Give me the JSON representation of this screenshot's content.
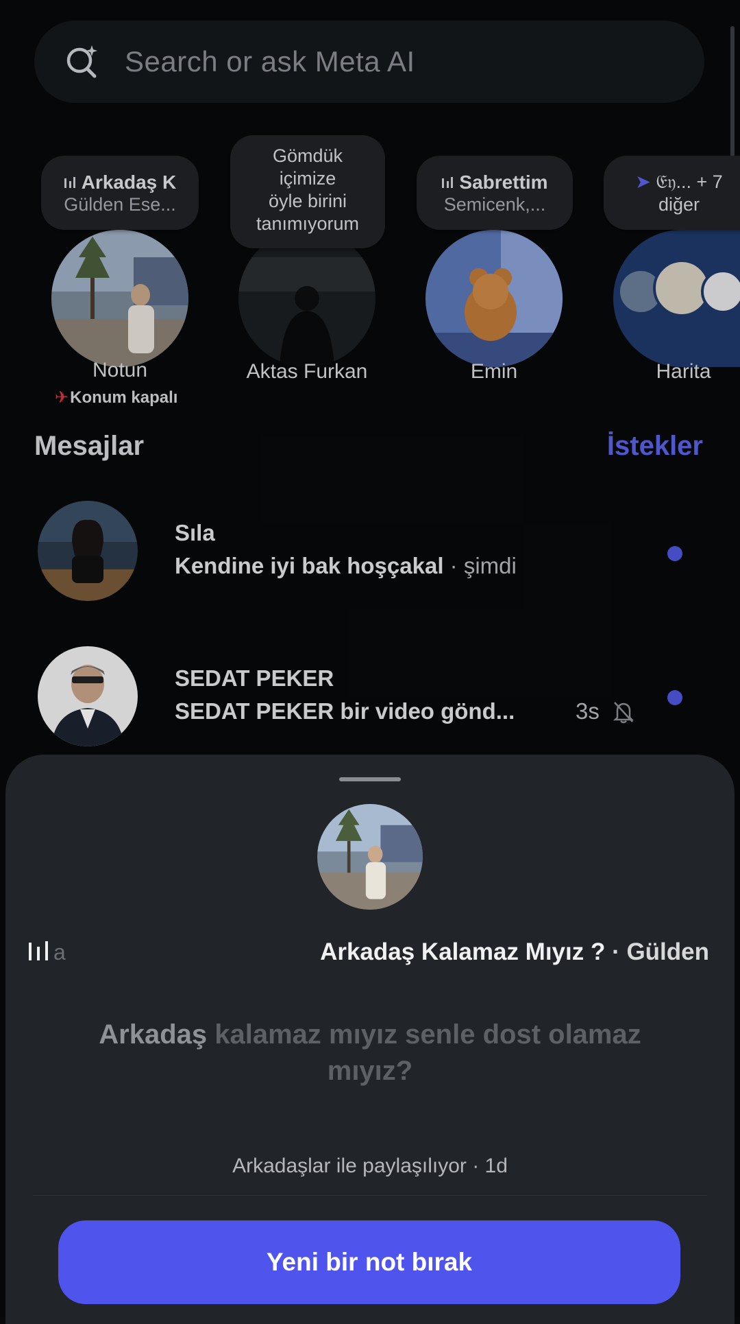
{
  "search": {
    "placeholder": "Search or ask Meta AI"
  },
  "notes": [
    {
      "bubble_title": "Arkadaş K",
      "bubble_sub": "Gülden Ese...",
      "name": "Notun",
      "status": "Konum kapalı"
    },
    {
      "bubble_text": [
        "Gömdük",
        "içimize",
        "öyle birini",
        "tanımıyorum"
      ],
      "name": "Aktas Furkan"
    },
    {
      "bubble_title": "Sabrettim",
      "bubble_sub": "Semicenk,...",
      "name": "Emin"
    },
    {
      "bubble_title": "𝔈𝔶... + 7",
      "bubble_sub": "diğer",
      "name": "Harita"
    }
  ],
  "section": {
    "title": "Mesajlar",
    "requests": "İstekler"
  },
  "messages": [
    {
      "name": "Sıla",
      "preview": "Kendine iyi bak hoşçakal",
      "time": " · şimdi",
      "unread": true,
      "muted": false
    },
    {
      "name": "SEDAT PEKER",
      "preview": "SEDAT PEKER bir video gönd...",
      "time": "3s",
      "unread": true,
      "muted": true
    }
  ],
  "sheet": {
    "music_faded": "a",
    "song": "Arkadaş Kalamaz Mıyız ?",
    "artist": " · Gülden",
    "lyrics_highlight": "Arkadaş",
    "lyrics_rest": " kalamaz mıyız senle dost olamaz mıyız?",
    "shared": "Arkadaşlar ile paylaşılıyor · 1d",
    "cta": "Yeni bir not bırak"
  },
  "colors": {
    "accent": "#4f55ec",
    "unread_dot": "#4f57e0",
    "sheet_bg": "#212428",
    "link": "#5b63e8"
  }
}
